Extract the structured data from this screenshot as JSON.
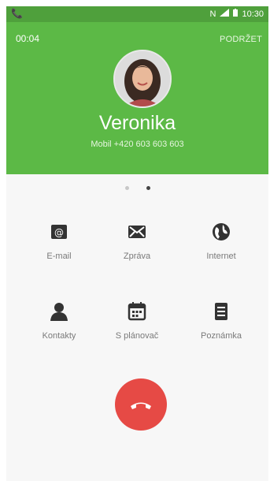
{
  "status_bar": {
    "time": "10:30"
  },
  "call": {
    "duration": "00:04",
    "hold_label": "PODRŽET",
    "contact_name": "Veronika",
    "number_line": "Mobil  +420 603 603 603"
  },
  "actions": [
    {
      "label": "E-mail",
      "icon": "email-icon"
    },
    {
      "label": "Zpráva",
      "icon": "message-icon"
    },
    {
      "label": "Internet",
      "icon": "globe-icon"
    },
    {
      "label": "Kontakty",
      "icon": "contacts-icon"
    },
    {
      "label": "S plánovač",
      "icon": "calendar-icon"
    },
    {
      "label": "Poznámka",
      "icon": "note-icon"
    }
  ],
  "colors": {
    "header_green": "#5cb946",
    "end_call_red": "#e64a45"
  }
}
